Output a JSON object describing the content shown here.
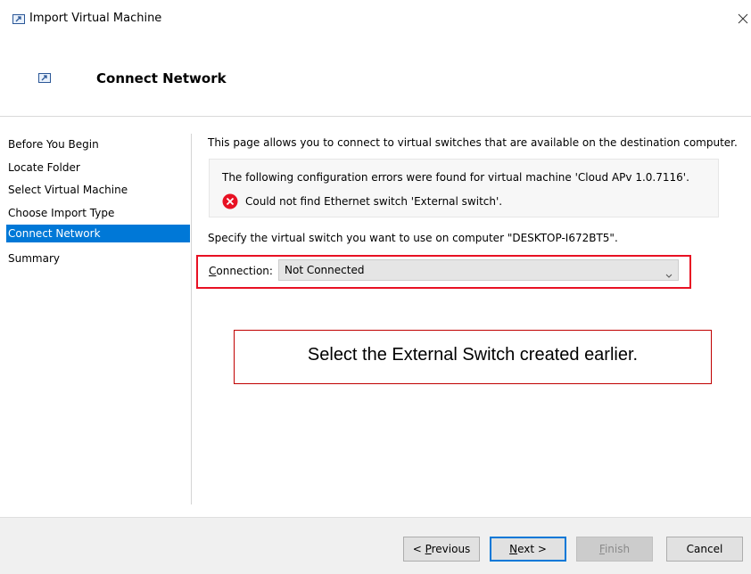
{
  "window": {
    "title": "Import Virtual Machine"
  },
  "header": {
    "title": "Connect Network"
  },
  "sidebar": {
    "items": [
      {
        "label": "Before You Begin"
      },
      {
        "label": "Locate Folder"
      },
      {
        "label": "Select Virtual Machine"
      },
      {
        "label": "Choose Import Type"
      },
      {
        "label": "Connect Network",
        "active": true
      },
      {
        "label": "Summary"
      }
    ]
  },
  "main": {
    "intro": "This page allows you to connect to virtual switches that are available on the destination computer.",
    "error_heading": "The following configuration errors were found for virtual machine 'Cloud APv 1.0.7116'.",
    "error_message": "Could not find Ethernet switch 'External switch'.",
    "specify": "Specify the virtual switch you want to use on computer \"DESKTOP-I672BT5\".",
    "connection_label_accel": "C",
    "connection_label_rest": "onnection:",
    "connection_value": "Not Connected",
    "callout": "Select the External Switch created earlier."
  },
  "footer": {
    "previous_prefix": "< ",
    "previous_accel": "P",
    "previous_rest": "revious",
    "next_accel": "N",
    "next_rest": "ext >",
    "finish_accel": "F",
    "finish_rest": "inish",
    "cancel": "Cancel"
  },
  "colors": {
    "accent": "#0078d7",
    "error": "#e81123",
    "callout_border": "#c00000"
  }
}
